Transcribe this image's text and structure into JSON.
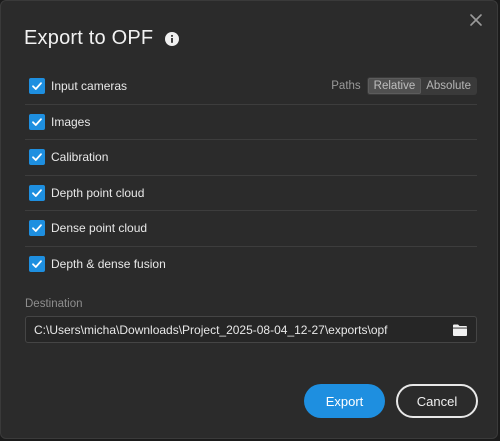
{
  "dialog": {
    "title": "Export to OPF",
    "title_icon": "info-icon",
    "close_icon": "close-icon"
  },
  "options": [
    {
      "label": "Input cameras",
      "checked": true
    },
    {
      "label": "Images",
      "checked": true
    },
    {
      "label": "Calibration",
      "checked": true
    },
    {
      "label": "Depth point cloud",
      "checked": true
    },
    {
      "label": "Dense point cloud",
      "checked": true
    },
    {
      "label": "Depth & dense fusion",
      "checked": true
    }
  ],
  "paths": {
    "label": "Paths",
    "options": [
      "Relative",
      "Absolute"
    ],
    "selected": "Relative"
  },
  "destination": {
    "label": "Destination",
    "value": "C:\\Users\\micha\\Downloads\\Project_2025-08-04_12-27\\exports\\opf",
    "browse_icon": "folder-icon"
  },
  "buttons": {
    "export_label": "Export",
    "cancel_label": "Cancel"
  },
  "colors": {
    "accent": "#1e8fe0",
    "background": "#2b2b2b"
  }
}
